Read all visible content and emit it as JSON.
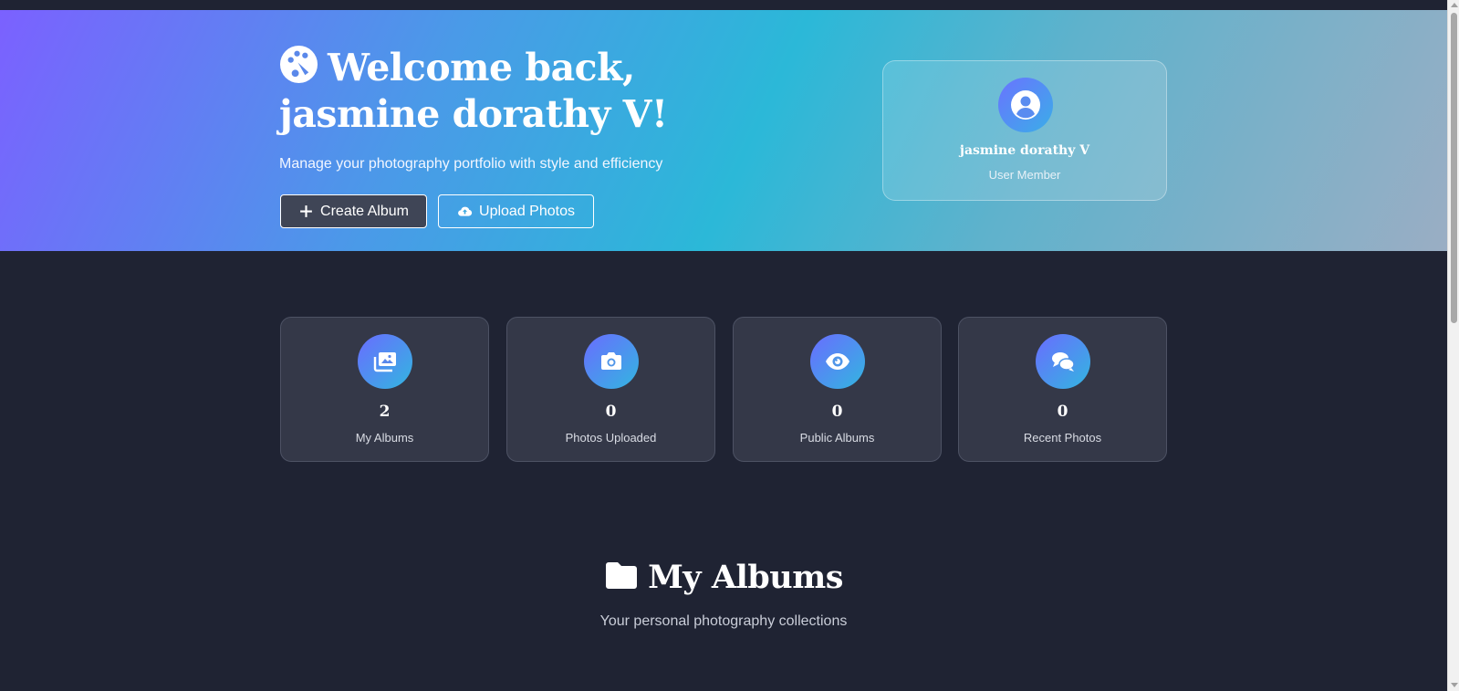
{
  "hero": {
    "title": "Welcome back, jasmine dorathy V!",
    "title_icon": "palette-icon",
    "subtitle": "Manage your photography portfolio with style and efficiency",
    "create_button": "Create Album",
    "create_icon": "plus-icon",
    "upload_button": "Upload Photos",
    "upload_icon": "cloud-upload-icon"
  },
  "profile": {
    "name": "jasmine dorathy V",
    "role": "User Member",
    "avatar_icon": "user-circle-icon"
  },
  "stats": [
    {
      "value": "2",
      "label": "My Albums",
      "icon": "images-icon"
    },
    {
      "value": "0",
      "label": "Photos Uploaded",
      "icon": "camera-icon"
    },
    {
      "value": "0",
      "label": "Public Albums",
      "icon": "eye-icon"
    },
    {
      "value": "0",
      "label": "Recent Photos",
      "icon": "comments-icon"
    }
  ],
  "albums_section": {
    "title": "My Albums",
    "icon": "folder-icon",
    "subtitle": "Your personal photography collections"
  },
  "colors": {
    "background": "#1f2333",
    "card": "#343848",
    "gradient_start": "#7b61ff",
    "gradient_mid": "#2bb8d8",
    "gradient_end": "#9aaec4"
  }
}
